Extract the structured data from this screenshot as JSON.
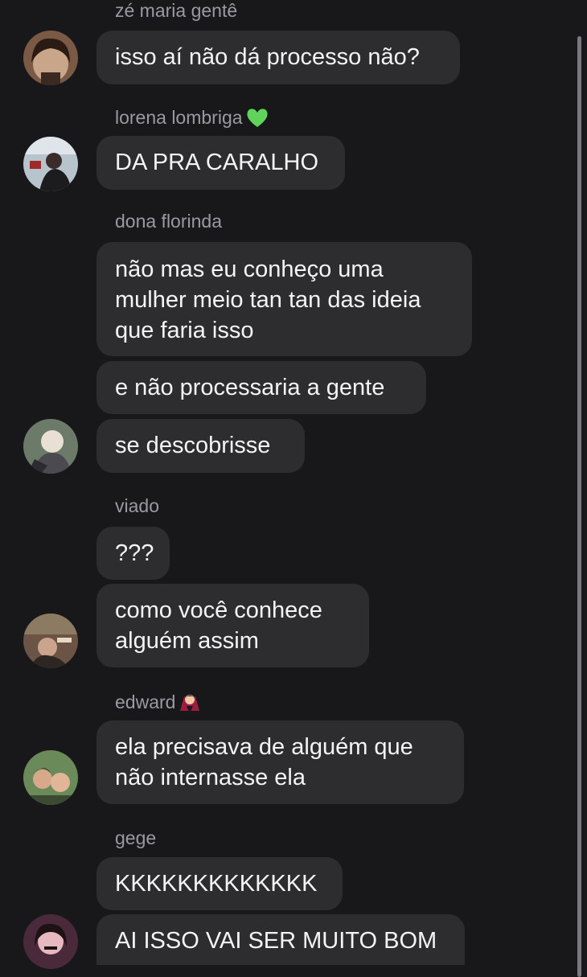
{
  "chat": {
    "groups": [
      {
        "sender": "zé maria gentê",
        "messages": [
          "isso aí não dá processo não?"
        ]
      },
      {
        "sender": "lorena lombriga",
        "sender_icon": "green-heart-icon",
        "messages": [
          "DA PRA CARALHO"
        ]
      },
      {
        "sender": "dona florinda",
        "messages": [
          "não mas eu conheço uma\nmulher meio tan tan das ideia\nque faria isso",
          "e não processaria a gente",
          "se descobrisse"
        ]
      },
      {
        "sender": "viado",
        "messages": [
          "???",
          "como você conhece\nalguém assim"
        ]
      },
      {
        "sender": "edward",
        "sender_icon": "vampire-woman-icon",
        "messages": [
          "ela precisava de alguém que\nnão internasse ela"
        ]
      },
      {
        "sender": "gege",
        "messages": [
          "KKKKKKKKKKKKK",
          "AI ISSO VAI SER MUITO BOM"
        ]
      }
    ]
  },
  "colors": {
    "background": "#18181a",
    "bubble": "#2d2d30",
    "message_text": "#f4f4f6",
    "sender_name": "#9a9a9f",
    "green_heart": "#5fd35a"
  }
}
